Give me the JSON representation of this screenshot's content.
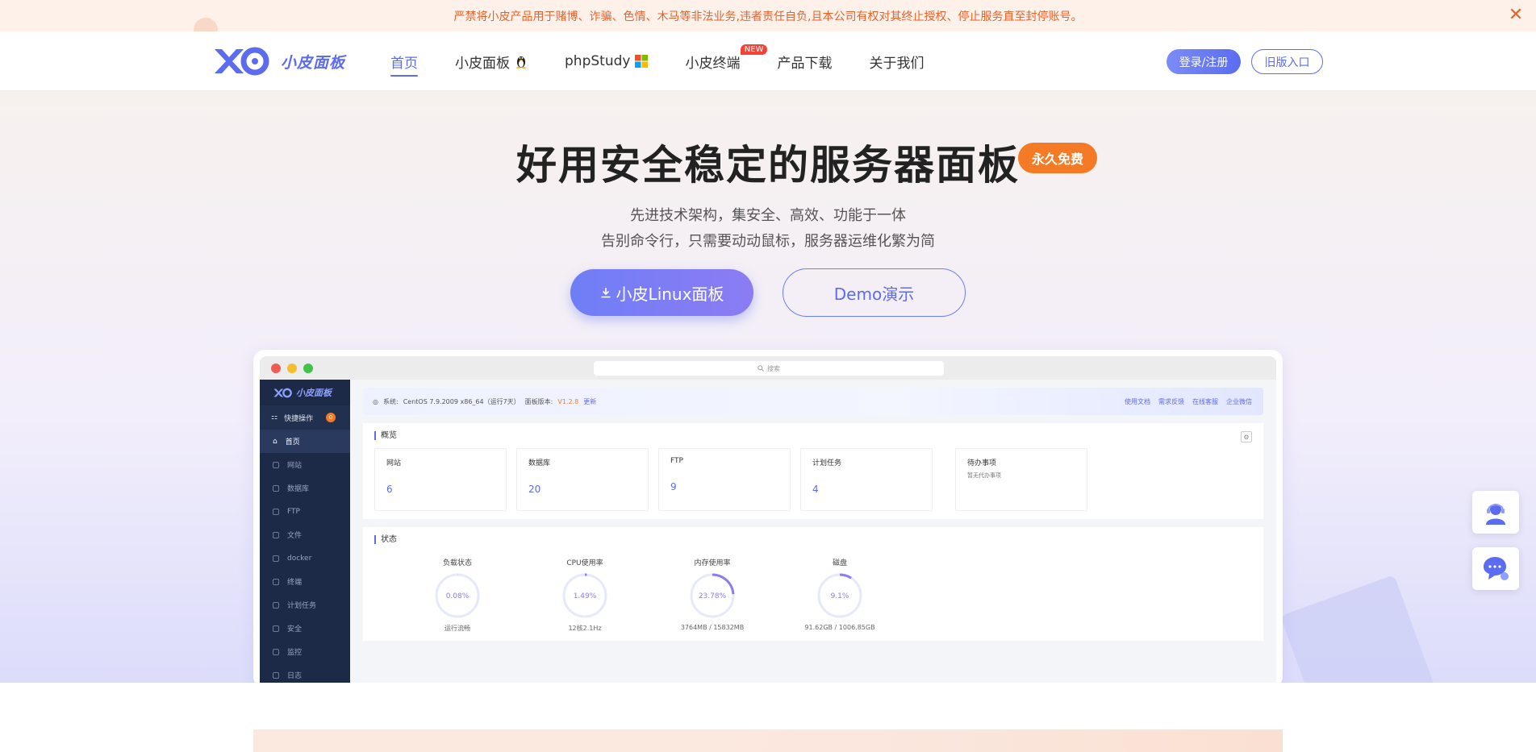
{
  "notice": {
    "text": "严禁将小皮产品用于赌博、诈骗、色情、木马等非法业务,违者责任自负,且本公司有权对其终止授权、停止服务直至封停账号。"
  },
  "header": {
    "logo_text": "小皮面板",
    "nav": [
      {
        "label": "首页"
      },
      {
        "label": "小皮面板"
      },
      {
        "label": "phpStudy"
      },
      {
        "label": "小皮终端",
        "badge": "NEW"
      },
      {
        "label": "产品下载"
      },
      {
        "label": "关于我们"
      }
    ],
    "login_label": "登录/注册",
    "old_label": "旧版入口"
  },
  "hero": {
    "title": "好用安全稳定的服务器面板",
    "badge": "永久免费",
    "subtitle1": "先进技术架构，集安全、高效、功能于一体",
    "subtitle2": "告别命令行，只需要动动鼠标，服务器运维化繁为简",
    "primary_button": "小皮Linux面板",
    "demo_button": "Demo演示"
  },
  "preview": {
    "search_placeholder": "搜索",
    "logo_text": "小皮面板",
    "quick_ops": "快捷操作",
    "quick_count": "0",
    "sidebar": [
      "首页",
      "网站",
      "数据库",
      "FTP",
      "文件",
      "docker",
      "终端",
      "计划任务",
      "安全",
      "监控",
      "日志"
    ],
    "sys": {
      "system_label": "系统:",
      "system_value": "CentOS 7.9.2009 x86_64（运行7天）",
      "version_label": "面板版本:",
      "version_value": "V1.2.8",
      "update": "更新",
      "links": [
        "使用文档",
        "需求反馈",
        "在线客服",
        "企业微信"
      ]
    },
    "overview_title": "概览",
    "stats": [
      {
        "label": "网站",
        "value": "6"
      },
      {
        "label": "数据库",
        "value": "20"
      },
      {
        "label": "FTP",
        "value": "9"
      },
      {
        "label": "计划任务",
        "value": "4"
      }
    ],
    "todo": {
      "label": "待办事项",
      "empty": "暂无代办事项"
    },
    "status_title": "状态",
    "gauges": [
      {
        "label": "负载状态",
        "value": "0.08%",
        "percent": 0.08,
        "detail": "运行流畅"
      },
      {
        "label": "CPU使用率",
        "value": "1.49%",
        "percent": 1.49,
        "detail": "12核2.1Hz"
      },
      {
        "label": "内存使用率",
        "value": "23.78%",
        "percent": 23.78,
        "detail": "3764MB / 15832MB"
      },
      {
        "label": "磁盘",
        "value": "9.1%",
        "percent": 9.1,
        "detail": "91.62GB / 1006.85GB"
      }
    ]
  },
  "colors": {
    "accent": "#5b6cf0",
    "orange": "#f47a25",
    "notice": "#e8622a",
    "sidebar": "#1c2a48"
  },
  "icons": [
    "close-icon",
    "linux-penguin-icon",
    "windows-icon",
    "download-icon",
    "customer-service-icon",
    "chat-icon",
    "search-icon",
    "gear-icon"
  ]
}
